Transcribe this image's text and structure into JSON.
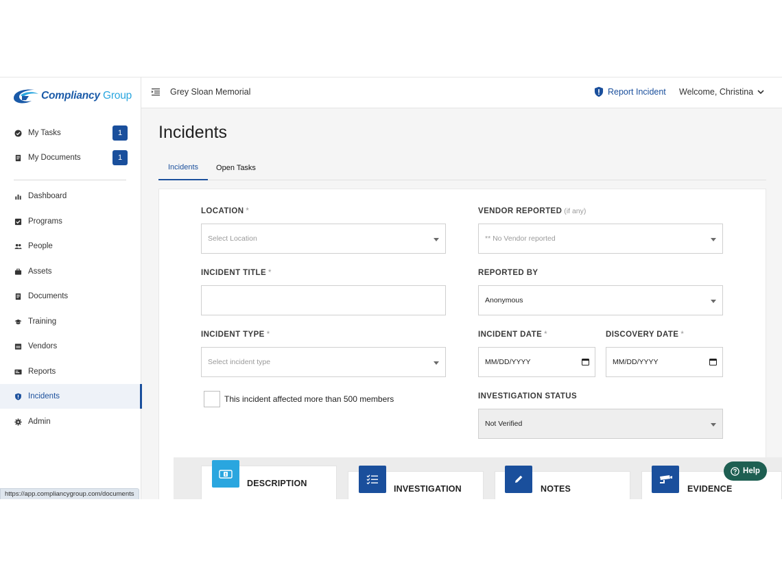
{
  "brand": {
    "name_part1": "Compliancy",
    "name_part2": " Group",
    "primary_color": "#1a4f9c",
    "accent_color": "#2aa6df"
  },
  "topbar": {
    "org_name": "Grey Sloan Memorial",
    "report_incident": "Report Incident",
    "welcome": "Welcome, Christina"
  },
  "sidebar": {
    "items": [
      {
        "label": "My Tasks",
        "icon": "check-circle-icon",
        "badge": "1"
      },
      {
        "label": "My Documents",
        "icon": "document-icon",
        "badge": "1"
      },
      {
        "label": "Dashboard",
        "icon": "bar-chart-icon"
      },
      {
        "label": "Programs",
        "icon": "checkbox-icon"
      },
      {
        "label": "People",
        "icon": "people-icon"
      },
      {
        "label": "Assets",
        "icon": "briefcase-icon"
      },
      {
        "label": "Documents",
        "icon": "document-icon"
      },
      {
        "label": "Training",
        "icon": "graduation-cap-icon"
      },
      {
        "label": "Vendors",
        "icon": "storefront-icon"
      },
      {
        "label": "Reports",
        "icon": "report-icon"
      },
      {
        "label": "Incidents",
        "icon": "shield-icon",
        "active": true
      },
      {
        "label": "Admin",
        "icon": "gear-icon"
      }
    ]
  },
  "status_url": "https://app.compliancygroup.com/documents",
  "page": {
    "title": "Incidents",
    "tabs": [
      {
        "label": "Incidents",
        "active": true
      },
      {
        "label": "Open Tasks"
      }
    ]
  },
  "form": {
    "location": {
      "label": "LOCATION",
      "required": "*",
      "placeholder": "Select Location"
    },
    "vendor": {
      "label": "VENDOR REPORTED",
      "hint": "(if any)",
      "value": "** No Vendor reported"
    },
    "title": {
      "label": "INCIDENT TITLE",
      "required": "*",
      "value": ""
    },
    "reported_by": {
      "label": "REPORTED BY",
      "value": "Anonymous"
    },
    "type": {
      "label": "INCIDENT TYPE",
      "required": "*",
      "placeholder": "Select incident type"
    },
    "incident_date": {
      "label": "INCIDENT DATE",
      "required": "*",
      "placeholder": "MM/DD/YYYY"
    },
    "discovery_date": {
      "label": "DISCOVERY DATE",
      "required": "*",
      "placeholder": "MM/DD/YYYY"
    },
    "affected": {
      "label": "This incident affected more than 500 members",
      "checked": false
    },
    "investigation_status": {
      "label": "INVESTIGATION STATUS",
      "value": "Not Verified"
    }
  },
  "sections": [
    {
      "label": "DESCRIPTION",
      "icon": "ticket-icon",
      "color": "#2aa6df"
    },
    {
      "label": "INVESTIGATION",
      "icon": "checklist-icon",
      "color": "#1a4f9c"
    },
    {
      "label": "NOTES",
      "icon": "pencil-icon",
      "color": "#1a4f9c"
    },
    {
      "label": "EVIDENCE",
      "icon": "camera-icon",
      "color": "#1a4f9c"
    }
  ],
  "help": {
    "label": "Help",
    "color": "#1e5f52"
  }
}
